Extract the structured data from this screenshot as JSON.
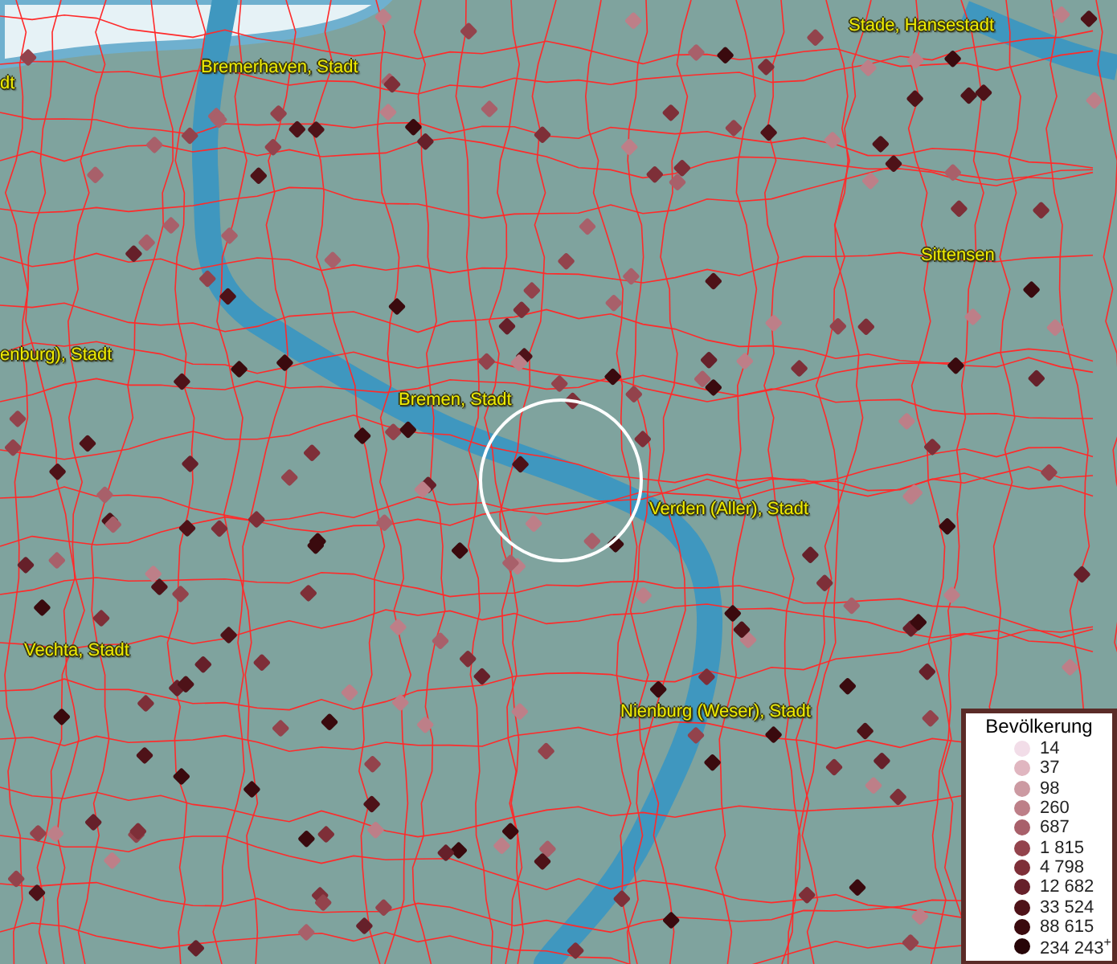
{
  "map": {
    "place_labels": [
      {
        "text": "dt"
      },
      {
        "text": "Bremerhaven, Stadt"
      },
      {
        "text": "Stade, Hansestadt"
      },
      {
        "text": "Sittensen"
      },
      {
        "text": "enburg), Stadt"
      },
      {
        "text": "Bremen, Stadt"
      },
      {
        "text": "Verden (Aller), Stadt"
      },
      {
        "text": "Vechta, Stadt"
      },
      {
        "text": "Nienburg (Weser), Stadt"
      }
    ]
  },
  "legend": {
    "title": "Bevölkerung",
    "items": [
      {
        "label": "14",
        "color": "#f2dde8"
      },
      {
        "label": "37",
        "color": "#e0b6c0"
      },
      {
        "label": "98",
        "color": "#cc9aa2"
      },
      {
        "label": "260",
        "color": "#bd7f88"
      },
      {
        "label": "687",
        "color": "#a8606a"
      },
      {
        "label": "1 815",
        "color": "#93434c"
      },
      {
        "label": "4 798",
        "color": "#7e2f38"
      },
      {
        "label": "12 682",
        "color": "#66202a"
      },
      {
        "label": "33 524",
        "color": "#4e1218"
      },
      {
        "label": "88 615",
        "color": "#3a0a0e"
      },
      {
        "label": "234 243$^{+}$",
        "color": "#270508"
      }
    ]
  }
}
